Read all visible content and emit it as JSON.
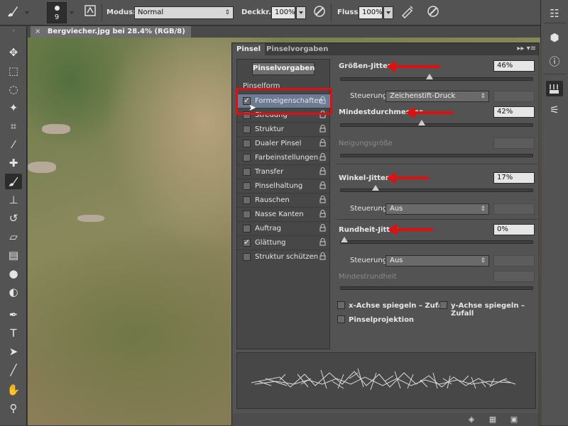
{
  "options_bar": {
    "brush_size": "9",
    "mode_label": "Modus:",
    "mode_value": "Normal",
    "opacity_label": "Deckkr.:",
    "opacity_value": "100%",
    "flow_label": "Fluss:",
    "flow_value": "100%"
  },
  "document": {
    "tab_title": "Bergviecher.jpg bei 28.4% (RGB/8)",
    "close_glyph": "×"
  },
  "panel": {
    "tabs": [
      {
        "label": "Pinsel"
      },
      {
        "label": "Pinselvorgaben"
      }
    ],
    "presets_button": "Pinselvorgaben",
    "brush_tip_label": "Pinselform",
    "list": [
      {
        "label": "Formeigenschaften",
        "checked": true
      },
      {
        "label": "Streuung",
        "checked": false
      },
      {
        "label": "Struktur",
        "checked": false
      },
      {
        "label": "Dualer Pinsel",
        "checked": false
      },
      {
        "label": "Farbeinstellungen",
        "checked": false
      },
      {
        "label": "Transfer",
        "checked": false
      },
      {
        "label": "Pinselhaltung",
        "checked": false
      },
      {
        "label": "Rauschen",
        "checked": false
      },
      {
        "label": "Nasse Kanten",
        "checked": false
      },
      {
        "label": "Auftrag",
        "checked": false
      },
      {
        "label": "Glättung",
        "checked": true
      },
      {
        "label": "Struktur schützen",
        "checked": false
      }
    ],
    "settings": {
      "size_jitter_label": "Größen-Jitter",
      "size_jitter_value": "46%",
      "size_jitter_level": 0.46,
      "control_label": "Steuerung:",
      "size_control_value": "Zeichenstift-Druck",
      "min_diameter_label": "Mindestdurchmesser",
      "min_diameter_value": "42%",
      "min_diameter_level": 0.42,
      "tilt_scale_label": "Neigungsgröße",
      "angle_jitter_label": "Winkel-Jitter",
      "angle_jitter_value": "17%",
      "angle_jitter_level": 0.17,
      "angle_control_value": "Aus",
      "roundness_jitter_label": "Rundheit-Jitter",
      "roundness_jitter_value": "0%",
      "roundness_jitter_level": 0.0,
      "roundness_control_value": "Aus",
      "min_roundness_label": "Mindestrundheit",
      "flip_x_label": "x-Achse spiegeln – Zufall",
      "flip_y_label": "y-Achse spiegeln – Zufall",
      "projection_label": "Pinselprojektion"
    }
  },
  "colors": {
    "highlight": "#e01010",
    "selected_row": "#6a7b93"
  }
}
